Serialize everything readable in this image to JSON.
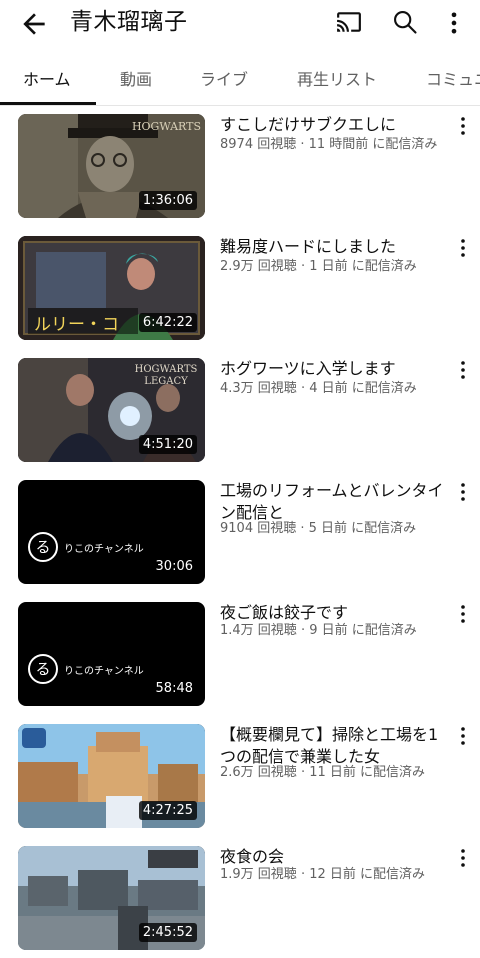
{
  "header": {
    "title": "青木瑠璃子",
    "back_icon": "arrow-left-icon",
    "cast_icon": "cast-icon",
    "search_icon": "search-icon",
    "more_icon": "more-vert-icon"
  },
  "tabs": [
    {
      "label": "ホーム",
      "active": true
    },
    {
      "label": "動画",
      "active": false
    },
    {
      "label": "ライブ",
      "active": false
    },
    {
      "label": "再生リスト",
      "active": false
    },
    {
      "label": "コミュニ",
      "active": false
    }
  ],
  "videos": [
    {
      "title": "すこしだけサブクエしに",
      "meta": "8974 回視聴 · 11 時間前 に配信済み",
      "duration": "1:36:06",
      "thumb_overlay_text": "HOGWARTS"
    },
    {
      "title": "難易度ハードにしました",
      "meta": "2.9万 回視聴 · 1 日前 に配信済み",
      "duration": "6:42:22",
      "thumb_overlay_text": "ルリー・コ"
    },
    {
      "title": "ホグワーツに入学します",
      "meta": "4.3万 回視聴 · 4 日前 に配信済み",
      "duration": "4:51:20",
      "thumb_overlay_text": "HOGWARTS LEGACY"
    },
    {
      "title": "工場のリフォームとバレンタイン配信と",
      "meta": "9104 回視聴 · 5 日前 に配信済み",
      "duration": "30:06",
      "channel_logo": "る",
      "channel_name": "りこのチャンネル"
    },
    {
      "title": "夜ご飯は餃子です",
      "meta": "1.4万 回視聴 · 9 日前 に配信済み",
      "duration": "58:48",
      "channel_logo": "る",
      "channel_name": "りこのチャンネル"
    },
    {
      "title": "【概要欄見て】掃除と工場を1つの配信で兼業した女",
      "meta": "2.6万 回視聴 · 11 日前 に配信済み",
      "duration": "4:27:25"
    },
    {
      "title": "夜食の会",
      "meta": "1.9万 回視聴 · 12 日前 に配信済み",
      "duration": "2:45:52"
    }
  ],
  "colors": {
    "text_primary": "#0f0f0f",
    "text_secondary": "#606060",
    "duration_bg": "#000000"
  }
}
